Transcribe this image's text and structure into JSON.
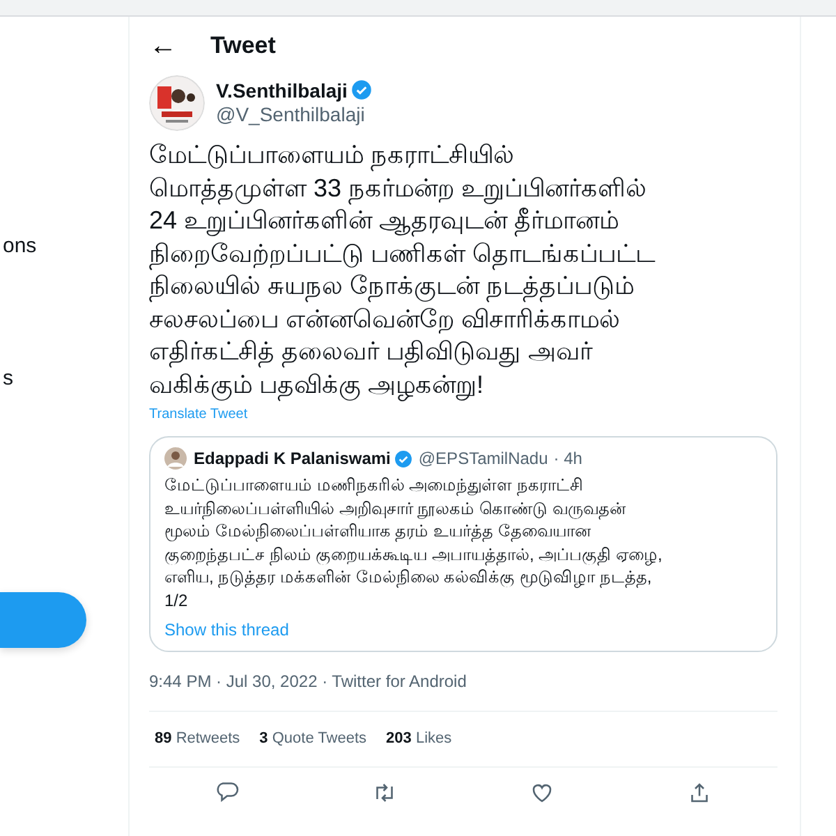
{
  "sidebar": {
    "items": [
      "ons",
      "s"
    ]
  },
  "header": {
    "back": "←",
    "title": "Tweet"
  },
  "tweet": {
    "author": "V.Senthilbalaji",
    "verified": true,
    "handle": "@V_Senthilbalaji",
    "text": "மேட்டுப்பாளையம் நகராட்சியில்\nமொத்தமுள்ள 33 நகர்மன்ற உறுப்பினர்களில்\n24 உறுப்பினர்களின் ஆதரவுடன் தீர்மானம்\nநிறைவேற்றப்பட்டு பணிகள் தொடங்கப்பட்ட\nநிலையில் சுயநல நோக்குடன் நடத்தப்படும்\nசலசலப்பை என்னவென்றே விசாரிக்காமல்\nஎதிர்கட்சித் தலைவர்  பதிவிடுவது அவர்\nவகிக்கும் பதவிக்கு அழகன்று!",
    "translate": "Translate Tweet",
    "quote": {
      "author": "Edappadi K Palaniswami",
      "verified": true,
      "handle": "@EPSTamilNadu",
      "time": "· 4h",
      "text": "மேட்டுப்பாளையம் மணிநகரில் அமைந்துள்ள நகராட்சி\nஉயர்நிலைப்பள்ளியில் அறிவுசார் நூலகம் கொண்டு வருவதன்\nமூலம் மேல்நிலைப்பள்ளியாக தரம் உயர்த்த தேவையான\nகுறைந்தபட்ச நிலம் குறையக்கூடிய அபாயத்தால், அப்பகுதி ஏழை,\nஎளிய, நடுத்தர மக்களின் மேல்நிலை கல்விக்கு மூடுவிழா நடத்த,\n1/2",
      "thread_link": "Show this thread"
    },
    "meta": "9:44 PM · Jul 30, 2022 · Twitter for Android",
    "stats": [
      {
        "count": "89",
        "label": "Retweets"
      },
      {
        "count": "3",
        "label": "Quote Tweets"
      },
      {
        "count": "203",
        "label": "Likes"
      }
    ],
    "actions": [
      {
        "kind": "reply"
      },
      {
        "kind": "retweet"
      },
      {
        "kind": "like"
      },
      {
        "kind": "share"
      }
    ]
  }
}
